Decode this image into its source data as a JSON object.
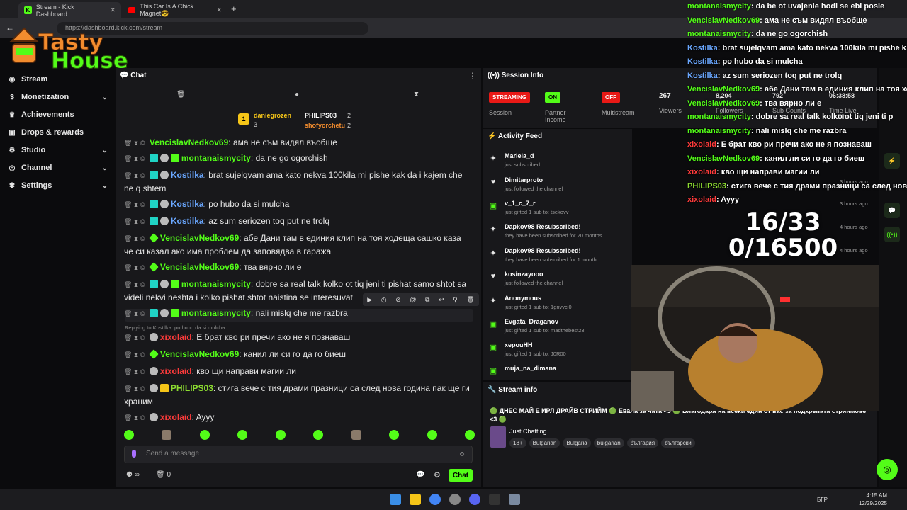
{
  "browser": {
    "tabs": [
      {
        "title": "Stream - Kick Dashboard",
        "active": true
      },
      {
        "title": "This Car Is A Chick Magnet😎",
        "active": false
      }
    ],
    "url": "https://dashboard.kick.com/stream"
  },
  "overlay_logo": {
    "line1": "Tasty",
    "line2": "House"
  },
  "sidebar": {
    "items": [
      {
        "label": "Stream",
        "icon": "stream-icon",
        "chevron": false
      },
      {
        "label": "Monetization",
        "icon": "dollar-icon",
        "chevron": true
      },
      {
        "label": "Achievements",
        "icon": "trophy-icon",
        "chevron": false
      },
      {
        "label": "Drops & rewards",
        "icon": "gift-icon",
        "chevron": false
      },
      {
        "label": "Studio",
        "icon": "gear-icon",
        "chevron": true
      },
      {
        "label": "Channel",
        "icon": "globe-icon",
        "chevron": true
      },
      {
        "label": "Settings",
        "icon": "cog-icon",
        "chevron": true
      }
    ]
  },
  "chat": {
    "title": "Chat",
    "leaderboard": [
      {
        "rank": "1",
        "name": "daniegrozen",
        "count": "3"
      },
      {
        "name": "PHILIPS03",
        "count": "2"
      },
      {
        "name": "shofyorchetu",
        "count": "2"
      }
    ],
    "messages": [
      {
        "user": "VencislavNedkov69",
        "color": "green",
        "text": ": ама не съм видял въобще"
      },
      {
        "user": "montanaismycity",
        "color": "green",
        "text": ": da ne go ogorchish"
      },
      {
        "user": "Kostilka",
        "color": "blue",
        "text": ": brat sujelqvam ama kato nekva 100kila mi pishe kak da i kajem che ne q shtem"
      },
      {
        "user": "Kostilka",
        "color": "blue",
        "text": ": po hubo da si mulcha"
      },
      {
        "user": "Kostilka",
        "color": "blue",
        "text": ": az sum seriozen toq put ne trolq"
      },
      {
        "user": "VencislavNedkov69",
        "color": "green",
        "text": ": абе Дани там в единия клип на тоя ходеща сашко каза че си казал ако има проблем да заповядва в гаража"
      },
      {
        "user": "VencislavNedkov69",
        "color": "green",
        "text": ": тва вярно ли е"
      },
      {
        "user": "montanaismycity",
        "color": "green",
        "text": ": dobre sa real talk kolko ot tiq jeni ti pishat samo shtot sa videli nekvi neshta i kolko pishat shtot naistina se interesuvat"
      },
      {
        "user": "montanaismycity",
        "color": "green",
        "text": ": nali mislq che me razbra"
      },
      {
        "user": "xixolaid",
        "color": "red",
        "text": ": Е брат кво ри пречи ако не я познаваш"
      },
      {
        "user": "VencislavNedkov69",
        "color": "green",
        "text": ": канил ли си го да го биеш"
      },
      {
        "user": "xixolaid",
        "color": "red",
        "text": ": кво щи направи магии ли"
      },
      {
        "user": "PHILIPS03",
        "color": "lime",
        "text": ": стига вече с тия драми празници са след нова година пак ще ги храним"
      },
      {
        "user": "xixolaid",
        "color": "red",
        "text": ": Ayyy"
      }
    ],
    "reply_hint": "Replying to Kostilka: po hubo da si mulcha",
    "input_placeholder": "Send a message",
    "send_label": "Chat",
    "footer_count": "0",
    "footer_infinity": "∞"
  },
  "session": {
    "title": "Session Info",
    "stats": [
      {
        "pill": "STREAMING",
        "pill_color": "#e91916",
        "label": "Session"
      },
      {
        "pill": "ON",
        "pill_color": "#53fc18",
        "label": "Partner Income"
      },
      {
        "pill": "OFF",
        "pill_color": "#e91916",
        "label": "Multistream"
      },
      {
        "value": "267",
        "label": "Viewers"
      },
      {
        "value": "8,204",
        "label": "Followers"
      },
      {
        "value": "792",
        "label": "Sub Counts"
      },
      {
        "value": "06:38:58",
        "label": "Time Live"
      }
    ]
  },
  "activity": {
    "title": "Activity Feed",
    "filter": "Filter",
    "items": [
      {
        "icon": "sparkle-icon",
        "name": "Mariela_d",
        "sub": "just subscribed",
        "time": ""
      },
      {
        "icon": "heart-icon",
        "name": "Dimitarproto",
        "sub": "just followed the channel",
        "time": "3 hours ago"
      },
      {
        "icon": "gift-icon",
        "name": "v_1_c_7_r",
        "sub": "just gifted 1 sub to: tsekovv",
        "time": "3 hours ago"
      },
      {
        "icon": "sparkle-icon",
        "name": "Dapkov98 Resubscribed!",
        "sub": "they have been subscribed for 20 months",
        "time": "4 hours ago"
      },
      {
        "icon": "sparkle-icon",
        "name": "Dapkov98 Resubscribed!",
        "sub": "they have been subscribed for 1 month",
        "time": "4 hours ago"
      },
      {
        "icon": "heart-icon",
        "name": "kosinzayooo",
        "sub": "just followed the channel",
        "time": ""
      },
      {
        "icon": "sparkle-icon",
        "name": "Anonymous",
        "sub": "just gifted 1 sub to: 1gnvvci0",
        "time": ""
      },
      {
        "icon": "gift-icon",
        "name": "Evgata_Draganov",
        "sub": "just gifted 1 sub to: madthebest23",
        "time": ""
      },
      {
        "icon": "gift-icon",
        "name": "xepouHH",
        "sub": "just gifted 1 sub to: J0R00",
        "time": ""
      },
      {
        "icon": "gift-icon",
        "name": "muja_na_dimana",
        "sub": "",
        "time": ""
      }
    ]
  },
  "stream_info": {
    "title": "Stream info",
    "stream_title": "🟢 ДНЕС МАЙ Е ИРЛ ДРАЙВ СТРИЙМ 🟢 Евала за чата <3 🟢 Благодаря на всеки един от вас за подкрепата стриймове <3 🟢",
    "category": "Just Chatting",
    "tags": [
      "18+",
      "Bulgarian",
      "Bulgaria",
      "bulgarian",
      "българия",
      "български"
    ]
  },
  "overlay": {
    "counter_line1": "16/33",
    "counter_line2": "0/16500",
    "chat": [
      {
        "user": "montanaismycity",
        "text": ": da be ot uvajenie hodi se ebi posle",
        "color": "#53fc18"
      },
      {
        "user": "VencislavNedkov69",
        "text": ": ама не съм видял въобще",
        "color": "#53fc18"
      },
      {
        "user": "montanaismycity",
        "text": ": da ne go ogorchish",
        "color": "#53fc18"
      },
      {
        "user": "Kostilka",
        "text": ": brat sujelqvam ama kato nekva 100kila mi pishe k",
        "color": "#6aa7ff"
      },
      {
        "user": "Kostilka",
        "text": ": po hubo da si mulcha",
        "color": "#6aa7ff"
      },
      {
        "user": "Kostilka",
        "text": ": az sum seriozen toq put ne trolq",
        "color": "#6aa7ff"
      },
      {
        "user": "VencislavNedkov69",
        "text": ": абе Дани там в единия клип на тоя хо",
        "color": "#53fc18"
      },
      {
        "user": "VencislavNedkov69",
        "text": ": тва вярно ли е",
        "color": "#53fc18"
      },
      {
        "user": "montanaismycity",
        "text": ": dobre sa real talk kolko ot tiq jeni ti p",
        "color": "#53fc18"
      },
      {
        "user": "montanaismycity",
        "text": ": nali mislq che me razbra",
        "color": "#53fc18"
      },
      {
        "user": "xixolaid",
        "text": ": Е брат кво ри пречи ако не я познаваш",
        "color": "#ff3b3b"
      },
      {
        "user": "VencislavNedkov69",
        "text": ": канил ли си го да го биеш",
        "color": "#53fc18"
      },
      {
        "user": "xixolaid",
        "text": ": кво щи направи магии ли",
        "color": "#ff3b3b"
      },
      {
        "user": "PHILIPS03",
        "text": ": стига вече с тия драми празници са след нов",
        "color": "#8ddc31"
      },
      {
        "user": "xixolaid",
        "text": ": Ayyy",
        "color": "#ff3b3b"
      }
    ]
  },
  "taskbar": {
    "lang": "БГР",
    "time": "4:15 AM",
    "date": "12/29/2025"
  }
}
